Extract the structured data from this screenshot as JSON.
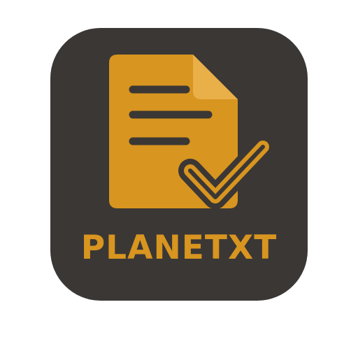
{
  "app": {
    "name": "PLANETXT",
    "icon": "document-check-icon"
  },
  "colors": {
    "background": "#3b3735",
    "accent": "#d8951f",
    "page": "#ffffff"
  }
}
